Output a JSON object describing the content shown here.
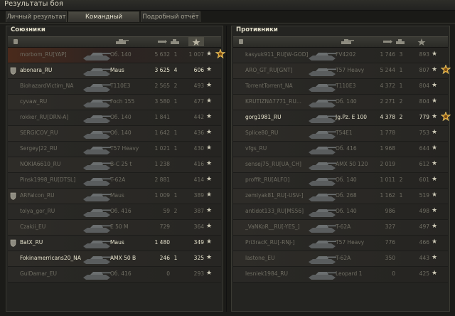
{
  "window": {
    "title": "Результаты боя"
  },
  "tabs": [
    {
      "label": "Личный результат",
      "active": false
    },
    {
      "label": "Командный результат",
      "active": true
    },
    {
      "label": "Подробный отчёт",
      "active": false
    }
  ],
  "columns": [
    "player-icon",
    "tank-icon",
    "damage-icon",
    "kills-icon",
    "xp-icon"
  ],
  "allies": {
    "title": "Союзники",
    "rows": [
      {
        "name": "morbom_RU[YAP]",
        "tank": "Об. 140",
        "damage": "5 632",
        "kills": "1",
        "xp": "1 007",
        "alive": false,
        "badge": false,
        "medal": true,
        "hl": true
      },
      {
        "name": "abonara_RU",
        "tank": "Maus",
        "damage": "3 625",
        "kills": "4",
        "xp": "606",
        "alive": true,
        "badge": true,
        "medal": false
      },
      {
        "name": "BiohazardVictim_NA",
        "tank": "T110E3",
        "damage": "2 565",
        "kills": "2",
        "xp": "493",
        "alive": false,
        "badge": false,
        "medal": false
      },
      {
        "name": "cyvaw_RU",
        "tank": "Foch 155",
        "damage": "3 580",
        "kills": "1",
        "xp": "477",
        "alive": false,
        "badge": false,
        "medal": false
      },
      {
        "name": "rokker_RU[DRN-A]",
        "tank": "Об. 140",
        "damage": "1 841",
        "kills": "",
        "xp": "442",
        "alive": false,
        "badge": false,
        "medal": false
      },
      {
        "name": "SERGICOV_RU",
        "tank": "Об. 140",
        "damage": "1 642",
        "kills": "1",
        "xp": "436",
        "alive": false,
        "badge": false,
        "medal": false
      },
      {
        "name": "Sergey|22_RU",
        "tank": "T57 Heavy",
        "damage": "1 021",
        "kills": "1",
        "xp": "430",
        "alive": false,
        "badge": false,
        "medal": false
      },
      {
        "name": "NOKIA6610_RU",
        "tank": "B-C 25 t",
        "damage": "1 238",
        "kills": "",
        "xp": "416",
        "alive": false,
        "badge": false,
        "medal": false
      },
      {
        "name": "Pinsk1998_RU[DTSL]",
        "tank": "T-62A",
        "damage": "2 881",
        "kills": "",
        "xp": "414",
        "alive": false,
        "badge": false,
        "medal": false
      },
      {
        "name": "ARFalcon_RU",
        "tank": "Maus",
        "damage": "1 009",
        "kills": "1",
        "xp": "389",
        "alive": false,
        "badge": true,
        "medal": false
      },
      {
        "name": "tolya_gor_RU",
        "tank": "Об. 416",
        "damage": "59",
        "kills": "2",
        "xp": "387",
        "alive": false,
        "badge": false,
        "medal": false
      },
      {
        "name": "Czakii_EU",
        "tank": "E 50 M",
        "damage": "729",
        "kills": "",
        "xp": "364",
        "alive": false,
        "badge": false,
        "medal": false
      },
      {
        "name": "BatX_RU",
        "tank": "Maus",
        "damage": "1 480",
        "kills": "",
        "xp": "349",
        "alive": true,
        "badge": true,
        "medal": false
      },
      {
        "name": "Fokinamerricans20_NA",
        "tank": "AMX 50 B",
        "damage": "246",
        "kills": "1",
        "xp": "325",
        "alive": true,
        "badge": false,
        "medal": false
      },
      {
        "name": "GulDamar_EU",
        "tank": "Об. 416",
        "damage": "0",
        "kills": "",
        "xp": "293",
        "alive": false,
        "badge": false,
        "medal": false
      }
    ]
  },
  "enemies": {
    "title": "Противники",
    "rows": [
      {
        "name": "kasyuk911_RU[W-GOD]",
        "tank": "FV4202",
        "damage": "1 746",
        "kills": "3",
        "xp": "893",
        "alive": false,
        "badge": false,
        "medal": false
      },
      {
        "name": "ARO_GT_RU[GNT]",
        "tank": "T57 Heavy",
        "damage": "5 244",
        "kills": "1",
        "xp": "807",
        "alive": false,
        "badge": false,
        "medal": true
      },
      {
        "name": "TorrentTorrent_NA",
        "tank": "T110E3",
        "damage": "4 372",
        "kills": "1",
        "xp": "804",
        "alive": false,
        "badge": false,
        "medal": false
      },
      {
        "name": "KRUTIZNA7771_RU...",
        "tank": "Об. 140",
        "damage": "2 271",
        "kills": "2",
        "xp": "804",
        "alive": false,
        "badge": false,
        "medal": false
      },
      {
        "name": "gorg1981_RU",
        "tank": "Jg.Pz. E 100",
        "damage": "4 378",
        "kills": "2",
        "xp": "779",
        "alive": true,
        "badge": false,
        "medal": true
      },
      {
        "name": "Splice80_RU",
        "tank": "T54E1",
        "damage": "1 778",
        "kills": "",
        "xp": "753",
        "alive": false,
        "badge": false,
        "medal": false
      },
      {
        "name": "vfgs_RU",
        "tank": "Об. 416",
        "damage": "1 968",
        "kills": "",
        "xp": "644",
        "alive": false,
        "badge": false,
        "medal": false
      },
      {
        "name": "sensej75_RU[UA_CH]",
        "tank": "AMX 50 120",
        "damage": "2 019",
        "kills": "",
        "xp": "612",
        "alive": false,
        "badge": false,
        "medal": false
      },
      {
        "name": "proffit_RU[ALFO]",
        "tank": "Об. 140",
        "damage": "1 011",
        "kills": "2",
        "xp": "601",
        "alive": false,
        "badge": false,
        "medal": false
      },
      {
        "name": "zemlyak81_RU[-USV-]",
        "tank": "Об. 268",
        "damage": "1 162",
        "kills": "1",
        "xp": "519",
        "alive": false,
        "badge": false,
        "medal": false
      },
      {
        "name": "antidot133_RU[MS56]",
        "tank": "Об. 140",
        "damage": "986",
        "kills": "",
        "xp": "498",
        "alive": false,
        "badge": false,
        "medal": false
      },
      {
        "name": "_VaNKoR__RU[-YES_]",
        "tank": "T-62A",
        "damage": "327",
        "kills": "",
        "xp": "497",
        "alive": false,
        "badge": false,
        "medal": false
      },
      {
        "name": "Pri3racK_RU[-RNJ-]",
        "tank": "T57 Heavy",
        "damage": "776",
        "kills": "",
        "xp": "466",
        "alive": false,
        "badge": false,
        "medal": false
      },
      {
        "name": "lastone_EU",
        "tank": "T-62A",
        "damage": "350",
        "kills": "",
        "xp": "443",
        "alive": false,
        "badge": false,
        "medal": false
      },
      {
        "name": "lesniek1984_RU",
        "tank": "Leopard 1",
        "damage": "0",
        "kills": "",
        "xp": "425",
        "alive": false,
        "badge": false,
        "medal": false
      }
    ]
  }
}
